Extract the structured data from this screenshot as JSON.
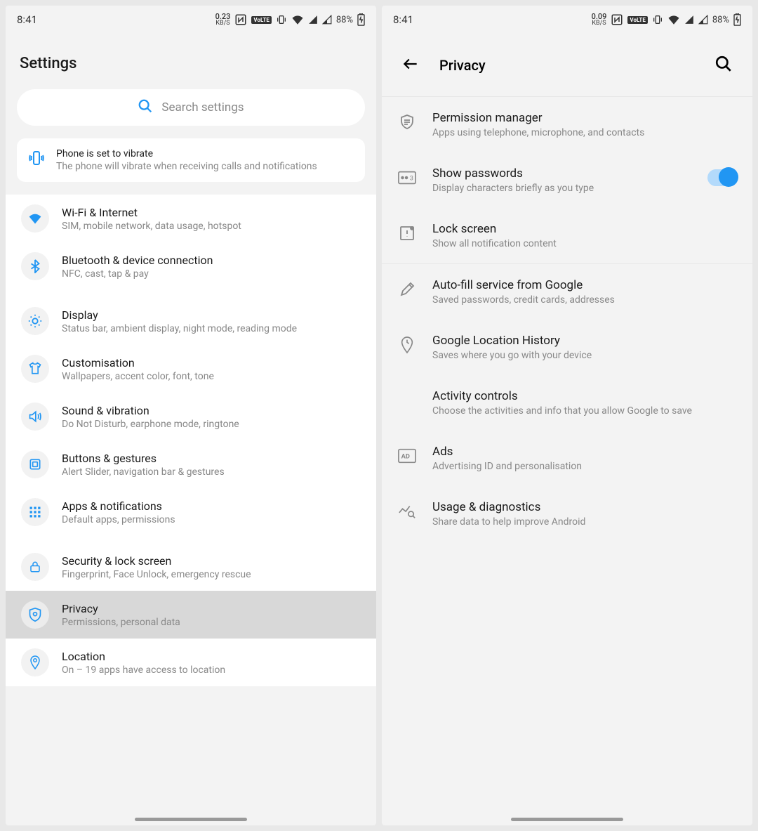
{
  "status": {
    "time": "8:41",
    "left_kbs": "0.23",
    "right_kbs": "0.09",
    "kbs_unit": "KB/S",
    "volte": "VoLTE",
    "battery": "88%"
  },
  "left_screen": {
    "title": "Settings",
    "search_placeholder": "Search settings",
    "notice": {
      "title": "Phone is set to vibrate",
      "subtitle": "The phone will vibrate when receiving calls and notifications"
    },
    "groups": [
      {
        "items": [
          {
            "icon": "wifi",
            "title": "Wi-Fi & Internet",
            "sub": "SIM, mobile network, data usage, hotspot"
          },
          {
            "icon": "bluetooth",
            "title": "Bluetooth & device connection",
            "sub": "NFC, cast, tap & pay"
          }
        ]
      },
      {
        "items": [
          {
            "icon": "display",
            "title": "Display",
            "sub": "Status bar, ambient display, night mode, reading mode"
          },
          {
            "icon": "customisation",
            "title": "Customisation",
            "sub": "Wallpapers, accent color, font, tone"
          },
          {
            "icon": "sound",
            "title": "Sound & vibration",
            "sub": "Do Not Disturb, earphone mode, ringtone"
          },
          {
            "icon": "buttons",
            "title": "Buttons & gestures",
            "sub": "Alert Slider, navigation bar & gestures"
          },
          {
            "icon": "apps",
            "title": "Apps & notifications",
            "sub": "Default apps, permissions"
          }
        ]
      },
      {
        "items": [
          {
            "icon": "security",
            "title": "Security & lock screen",
            "sub": "Fingerprint, Face Unlock, emergency rescue"
          },
          {
            "icon": "privacy",
            "title": "Privacy",
            "sub": "Permissions, personal data",
            "highlighted": true
          },
          {
            "icon": "location",
            "title": "Location",
            "sub": "On – 19 apps have access to location"
          }
        ]
      }
    ]
  },
  "right_screen": {
    "title": "Privacy",
    "groups": [
      {
        "items": [
          {
            "icon": "permission",
            "title": "Permission manager",
            "sub": "Apps using telephone, microphone, and contacts"
          },
          {
            "icon": "password",
            "title": "Show passwords",
            "sub": "Display characters briefly as you type",
            "toggle": true
          },
          {
            "icon": "lockscreen",
            "title": "Lock screen",
            "sub": "Show all notification content"
          }
        ]
      },
      {
        "items": [
          {
            "icon": "autofill",
            "title": "Auto-fill service from Google",
            "sub": "Saved passwords, credit cards, addresses"
          },
          {
            "icon": "history",
            "title": "Google Location History",
            "sub": "Saves where you go with your device"
          },
          {
            "icon": "",
            "title": "Activity controls",
            "sub": "Choose the activities and info that you allow Google to save"
          },
          {
            "icon": "ads",
            "title": "Ads",
            "sub": "Advertising ID and personalisation"
          },
          {
            "icon": "usage",
            "title": "Usage & diagnostics",
            "sub": "Share data to help improve Android"
          }
        ]
      }
    ]
  }
}
